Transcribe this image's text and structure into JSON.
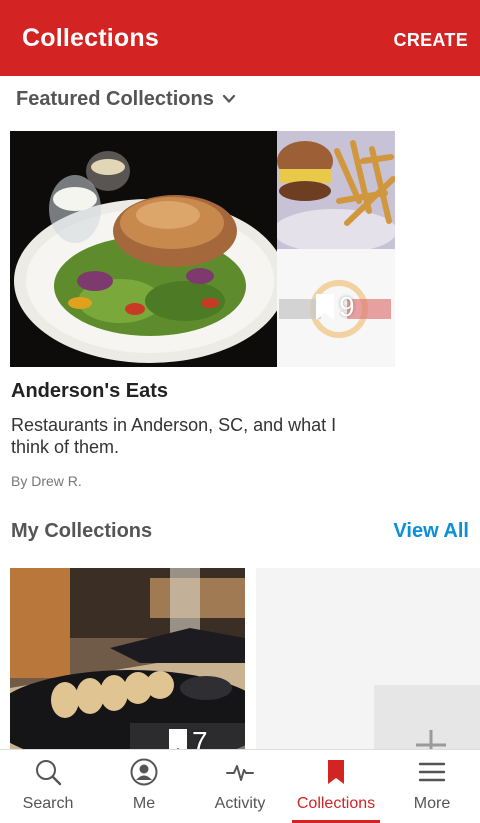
{
  "header": {
    "title": "Collections",
    "create_label": "CREATE"
  },
  "featured": {
    "toggle_label": "Featured Collections",
    "collection": {
      "count": "9",
      "title": "Anderson's Eats",
      "description": "Restaurants in Anderson, SC, and what I think of them.",
      "author": "By Drew R."
    }
  },
  "my_collections": {
    "title": "My Collections",
    "view_all_label": "View All",
    "first": {
      "count": "7"
    }
  },
  "tabs": [
    {
      "label": "Search",
      "icon": "search-icon"
    },
    {
      "label": "Me",
      "icon": "profile-icon"
    },
    {
      "label": "Activity",
      "icon": "activity-icon"
    },
    {
      "label": "Collections",
      "icon": "bookmark-icon",
      "active": true
    },
    {
      "label": "More",
      "icon": "menu-icon"
    }
  ],
  "colors": {
    "brand": "#d32323",
    "link": "#0a8fd8"
  }
}
